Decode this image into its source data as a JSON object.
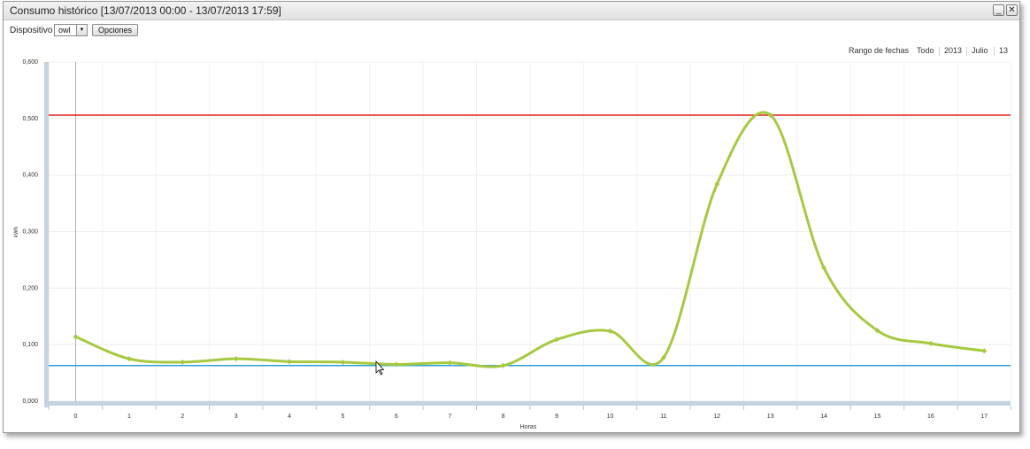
{
  "window": {
    "title": "Consumo histórico [13/07/2013 00:00 - 13/07/2013 17:59]",
    "minimize_icon": "minimize-icon",
    "close_icon": "close-icon"
  },
  "toolbar": {
    "device_label": "Dispositivo",
    "device_value": "owl",
    "options_label": "Opciones"
  },
  "date_range": {
    "label": "Rango de fechas",
    "links": [
      "Todo",
      "2013",
      "Julio",
      "13"
    ]
  },
  "chart_data": {
    "type": "line",
    "xlabel": "Horas",
    "ylabel": "kWh",
    "x": [
      0,
      1,
      2,
      3,
      4,
      5,
      6,
      7,
      8,
      9,
      10,
      11,
      12,
      13,
      14,
      15,
      16,
      17
    ],
    "series": [
      {
        "values": [
          0.114,
          0.075,
          0.069,
          0.075,
          0.07,
          0.069,
          0.065,
          0.068,
          0.063,
          0.109,
          0.124,
          0.077,
          0.384,
          0.506,
          0.236,
          0.125,
          0.102,
          0.089
        ],
        "color": "#a6c940"
      }
    ],
    "reference_lines": [
      {
        "value": 0.506,
        "color": "#e02020"
      },
      {
        "value": 0.063,
        "color": "#2a9fd8"
      }
    ],
    "yticks": [
      "0,000",
      "0,100",
      "0,200",
      "0,300",
      "0,400",
      "0,500",
      "0,600"
    ],
    "xticks": [
      "0",
      "1",
      "2",
      "3",
      "4",
      "5",
      "6",
      "7",
      "8",
      "9",
      "10",
      "11",
      "12",
      "13",
      "14",
      "15",
      "16",
      "17"
    ],
    "ylim": [
      0,
      0.6
    ],
    "grid": true
  }
}
